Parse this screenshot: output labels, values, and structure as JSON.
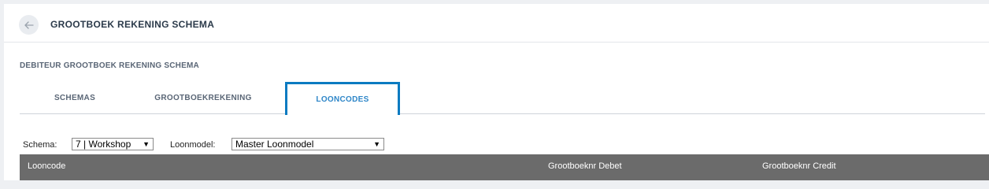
{
  "header": {
    "title": "GROOTBOEK REKENING SCHEMA",
    "back_icon": "arrow-left-icon"
  },
  "section": {
    "title": "DEBITEUR GROOTBOEK REKENING SCHEMA"
  },
  "tabs": [
    {
      "label": "SCHEMAS",
      "active": false
    },
    {
      "label": "GROOTBOEKREKENING",
      "active": false
    },
    {
      "label": "LOONCODES",
      "active": true
    }
  ],
  "filters": {
    "schema_label": "Schema:",
    "schema_value": "7 | Workshop",
    "loonmodel_label": "Loonmodel:",
    "loonmodel_value": "Master Loonmodel",
    "arrow": "▼"
  },
  "table": {
    "columns": [
      "Looncode",
      "Grootboeknr Debet",
      "Grootboeknr Credit"
    ]
  },
  "colors": {
    "accent": "#0b7bc1",
    "active_tab_text": "#2e86c8",
    "table_header_bg": "#6b6b6b"
  }
}
